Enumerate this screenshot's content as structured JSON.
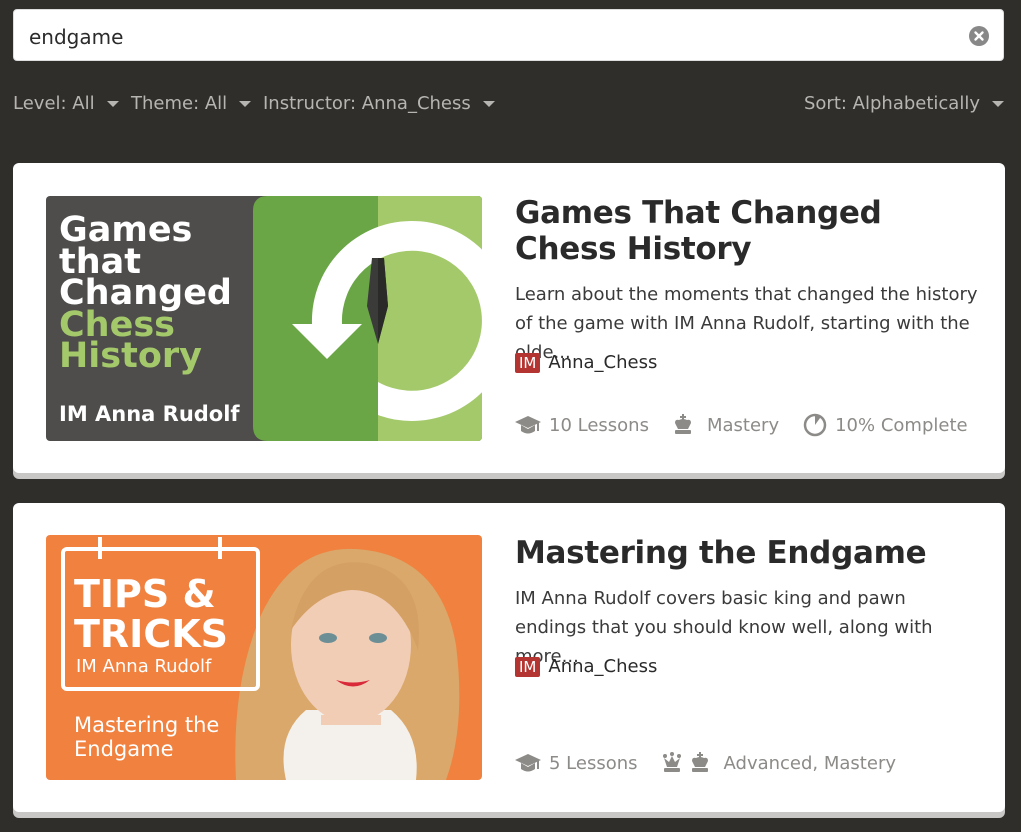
{
  "search": {
    "value": "endgame"
  },
  "filters": {
    "level": "Level: All",
    "theme": "Theme: All",
    "instructor": "Instructor: Anna_Chess",
    "sort": "Sort: Alphabetically"
  },
  "courses": [
    {
      "title": "Games That Changed Chess History",
      "description": "Learn about the moments that changed the history of the game with IM Anna Rudolf, starting with the olde...",
      "author_title": "IM",
      "author": "Anna_Chess",
      "lessons": "10 Lessons",
      "level": "Mastery",
      "progress_text": "10% Complete",
      "progress": 0.1,
      "thumb": {
        "line1": "Games",
        "line2": "that",
        "line3": "Changed",
        "line4": "Chess",
        "line5": "History",
        "byline": "IM Anna Rudolf"
      }
    },
    {
      "title": "Mastering the Endgame",
      "description": "IM Anna Rudolf covers basic king and pawn endings that you should know well, along with more...",
      "author_title": "IM",
      "author": "Anna_Chess",
      "lessons": "5 Lessons",
      "level": "Advanced, Mastery",
      "thumb": {
        "line1": "TIPS &",
        "line2": "TRICKS",
        "line3": "IM Anna Rudolf",
        "line4": "Mastering the",
        "line5": "Endgame"
      }
    }
  ],
  "colors": {
    "background": "#302e2b",
    "badge": "#b33430",
    "green_dark": "#5e9c3b",
    "green_light": "#a0c765",
    "orange": "#f0813f"
  }
}
